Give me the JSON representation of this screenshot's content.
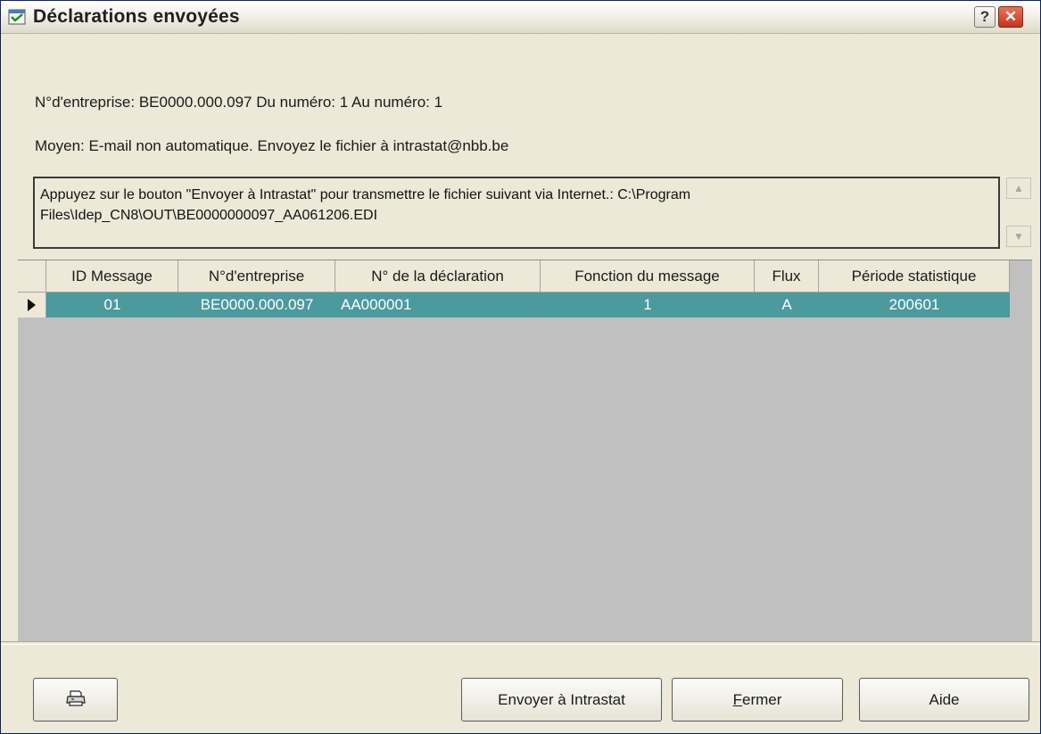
{
  "window": {
    "title": "Déclarations envoyées",
    "help_button": "?",
    "close_button": "✕"
  },
  "info": {
    "line1": "N°d'entreprise: BE0000.000.097  Du numéro: 1  Au numéro: 1",
    "line2": "Moyen: E-mail non automatique. Envoyez le fichier à intrastat@nbb.be"
  },
  "message": {
    "text": "Appuyez sur le bouton \"Envoyer à Intrastat\" pour transmettre le fichier suivant via Internet.: C:\\Program Files\\Idep_CN8\\OUT\\BE0000000097_AA061206.EDI"
  },
  "grid": {
    "columns": [
      "ID Message",
      "N°d'entreprise",
      "N° de la déclaration",
      "Fonction du message",
      "Flux",
      "Période statistique"
    ],
    "rows": [
      {
        "id": "01",
        "enterprise": "BE0000.000.097",
        "declaration": "AA000001",
        "function": "1",
        "flux": "A",
        "period": "200601"
      }
    ]
  },
  "buttons": {
    "print_icon": "printer-icon",
    "send": "Envoyer à Intrastat",
    "close_first": "F",
    "close_rest": "ermer",
    "help": "Aide"
  },
  "colors": {
    "selected_row": "#4a9a9e",
    "grid_background": "#c0c0c0",
    "window_background": "#ece9d8"
  }
}
